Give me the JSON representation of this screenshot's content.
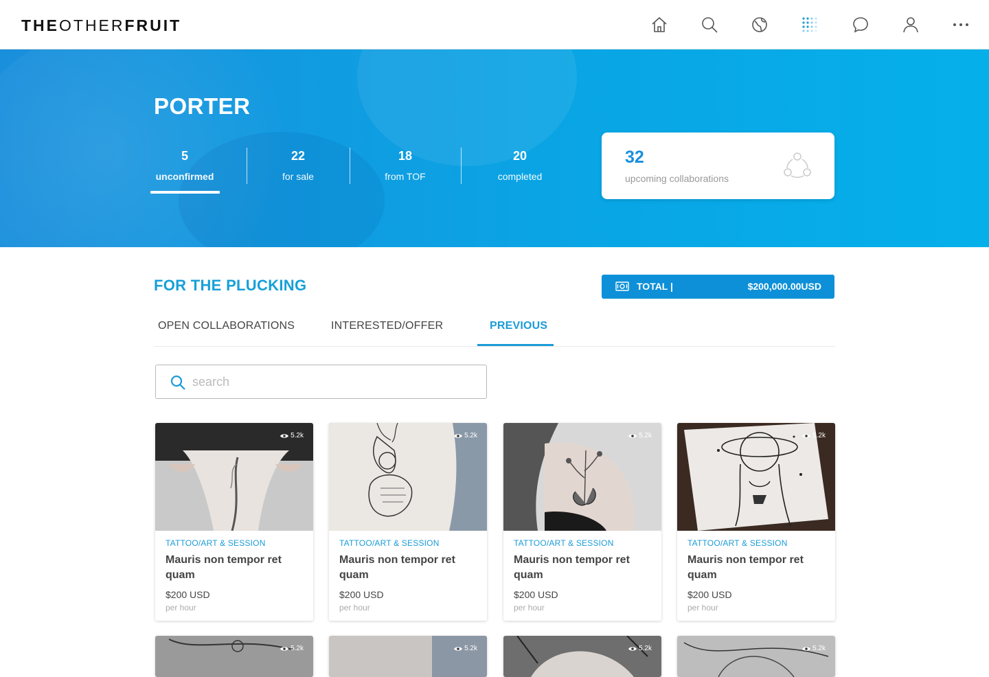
{
  "app": {
    "logo_bold1": "THE",
    "logo_thin": "OTHER",
    "logo_bold2": "FRUIT"
  },
  "nav": {
    "icons": [
      "home-icon",
      "search-icon",
      "globe-icon",
      "grid-dots-icon",
      "chat-icon",
      "user-icon",
      "more-icon"
    ]
  },
  "hero": {
    "name": "PORTER",
    "stats": [
      {
        "num": "5",
        "label": "unconfirmed"
      },
      {
        "num": "22",
        "label": "for sale"
      },
      {
        "num": "18",
        "label": "from TOF"
      },
      {
        "num": "20",
        "label": "completed"
      }
    ],
    "upcoming": {
      "num": "32",
      "label": "upcoming collaborations"
    }
  },
  "section": {
    "title": "FOR THE PLUCKING",
    "total_label": "TOTAL |",
    "total_amount": "$200,000.00USD"
  },
  "tabs": [
    {
      "label": "OPEN COLLABORATIONS"
    },
    {
      "label": "INTERESTED/OFFER"
    },
    {
      "label": "PREVIOUS"
    }
  ],
  "search": {
    "placeholder": "search"
  },
  "cards": [
    {
      "views": "5.2k",
      "category": "TATTOO/ART & SESSION",
      "title": "Mauris non tempor ret quam",
      "price": "$200 USD",
      "unit": "per hour"
    },
    {
      "views": "5.2k",
      "category": "TATTOO/ART & SESSION",
      "title": "Mauris non tempor ret quam",
      "price": "$200 USD",
      "unit": "per hour"
    },
    {
      "views": "5.2k",
      "category": "TATTOO/ART & SESSION",
      "title": "Mauris non tempor ret quam",
      "price": "$200 USD",
      "unit": "per hour"
    },
    {
      "views": "5.2k",
      "category": "TATTOO/ART & SESSION",
      "title": "Mauris non tempor ret quam",
      "price": "$200 USD",
      "unit": "per hour"
    }
  ],
  "cards_row2": [
    {
      "views": "5.2k"
    },
    {
      "views": "5.2k"
    },
    {
      "views": "5.2k"
    },
    {
      "views": "5.2k"
    }
  ],
  "colors": {
    "accent": "#1a9bd8",
    "hero": "#0aa4e4",
    "total_bar": "#0e90d8"
  }
}
